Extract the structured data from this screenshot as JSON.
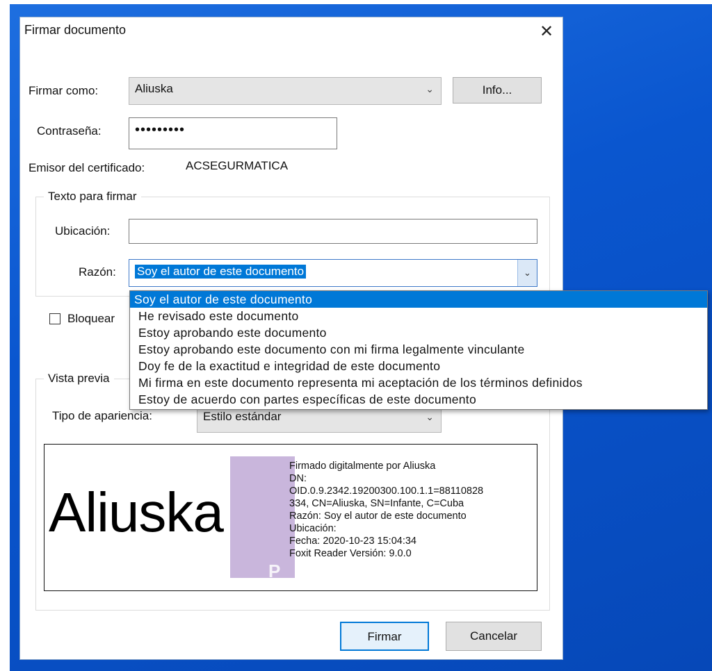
{
  "dialog": {
    "title": "Firmar documento",
    "close": "✕"
  },
  "sign_as": {
    "label": "Firmar como:",
    "value": "Aliuska",
    "info_button": "Info..."
  },
  "password": {
    "label": "Contraseña:",
    "masked_value": "•••••••••"
  },
  "issuer": {
    "label": "Emisor del certificado:",
    "value": "ACSEGURMATICA"
  },
  "sign_text_group": {
    "title": "Texto para firmar",
    "location_label": "Ubicación:",
    "location_value": "",
    "reason_label": "Razón:",
    "reason_value": "Soy el autor de este documento"
  },
  "reason_options": [
    "Soy el autor de este documento",
    "He revisado este documento",
    "Estoy aprobando este documento",
    "Estoy aprobando este documento con mi firma legalmente vinculante",
    "Doy fe de la exactitud e integridad de este documento",
    "Mi firma en este documento representa mi aceptación de los términos definidos",
    "Estoy de acuerdo con partes específicas de este documento"
  ],
  "lock_checkbox": {
    "label": "Bloquear",
    "checked": false
  },
  "preview_group": {
    "title": "Vista previa",
    "appearance_label": "Tipo de apariencia:",
    "appearance_value": "Estilo estándar"
  },
  "signature_preview": {
    "name": "Aliuska",
    "logo_text": "P",
    "lines": [
      "Firmado digitalmente por Aliuska",
      "DN:",
      "OID.0.9.2342.19200300.100.1.1=88110828",
      "334, CN=Aliuska, SN=Infante, C=Cuba",
      "Razón: Soy el autor de este documento",
      "Ubicación:",
      "Fecha: 2020-10-23 15:04:34",
      "Foxit Reader Versión: 9.0.0"
    ]
  },
  "buttons": {
    "sign": "Firmar",
    "cancel": "Cancelar"
  },
  "icons": {
    "chevron": "chevron-down-icon",
    "close": "close-icon"
  },
  "colors": {
    "desktop": "#0a56cf",
    "selection": "#0078d7"
  }
}
